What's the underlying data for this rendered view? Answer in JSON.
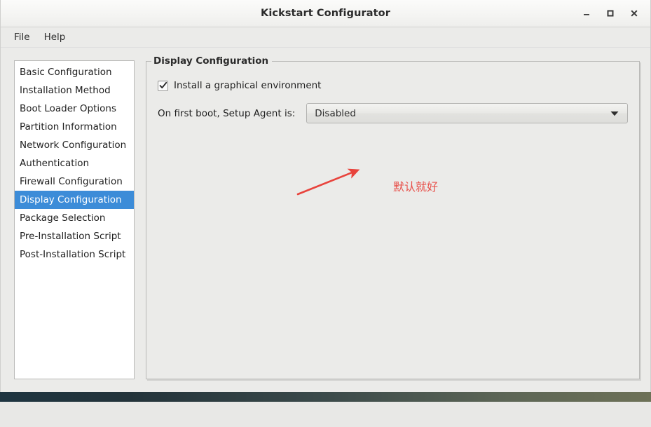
{
  "window": {
    "title": "Kickstart Configurator",
    "controls": [
      {
        "name": "minimize-button",
        "label": "–"
      },
      {
        "name": "maximize-button",
        "label": "□"
      },
      {
        "name": "close-button",
        "label": "✕"
      }
    ]
  },
  "menubar": {
    "items": [
      {
        "label": "File"
      },
      {
        "label": "Help"
      }
    ]
  },
  "sidebar": {
    "items": [
      {
        "label": "Basic Configuration",
        "selected": false
      },
      {
        "label": "Installation Method",
        "selected": false
      },
      {
        "label": "Boot Loader Options",
        "selected": false
      },
      {
        "label": "Partition Information",
        "selected": false
      },
      {
        "label": "Network Configuration",
        "selected": false
      },
      {
        "label": "Authentication",
        "selected": false
      },
      {
        "label": "Firewall Configuration",
        "selected": false
      },
      {
        "label": "Display Configuration",
        "selected": true
      },
      {
        "label": "Package Selection",
        "selected": false
      },
      {
        "label": "Pre-Installation Script",
        "selected": false
      },
      {
        "label": "Post-Installation Script",
        "selected": false
      }
    ]
  },
  "main": {
    "groupbox_title": "Display Configuration",
    "checkbox": {
      "label": "Install a graphical environment",
      "checked": true
    },
    "setup_agent": {
      "label": "On first boot, Setup Agent is:",
      "value": "Disabled"
    }
  },
  "annotation": {
    "text": "默认就好",
    "color": "#e8504a"
  },
  "colors": {
    "selection": "#3c8cd8",
    "window_bg": "#ebebe9",
    "list_bg": "#ffffff",
    "annotation_red": "#e8504a"
  }
}
